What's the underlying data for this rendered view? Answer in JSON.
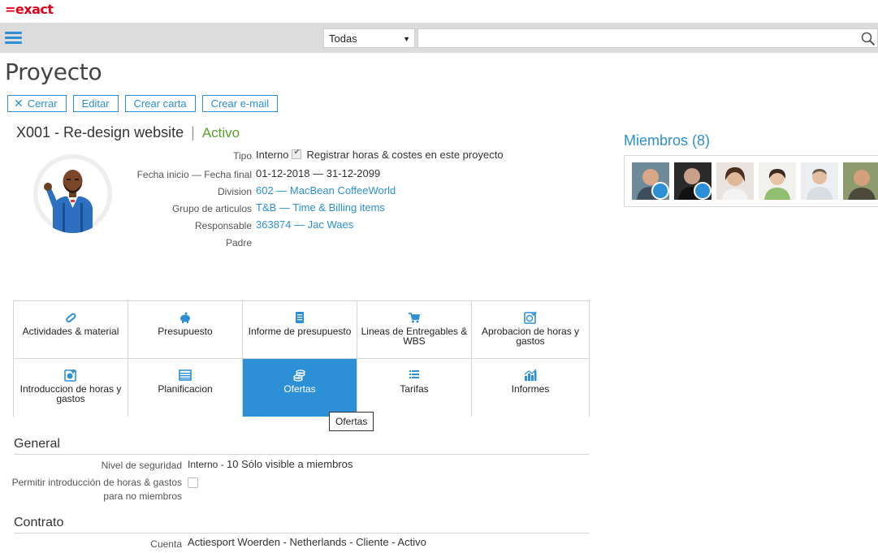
{
  "brand": {
    "logo": "=exact"
  },
  "topbar": {
    "scope_selected": "Todas",
    "search_placeholder": ""
  },
  "page": {
    "title": "Proyecto"
  },
  "actions": {
    "close": "Cerrar",
    "edit": "Editar",
    "create_letter": "Crear carta",
    "create_email": "Crear e-mail"
  },
  "project": {
    "code_name": "X001 - Re-design website",
    "separator": "|",
    "status": "Activo",
    "props": [
      {
        "label": "Tipo",
        "value": "Interno",
        "checkbox_text": "Registrar horas & costes en este proyecto"
      },
      {
        "label": "Fecha inicio — Fecha final",
        "value": "01-12-2018 — 31-12-2099"
      },
      {
        "label": "Division",
        "value": "602 — MacBean CoffeeWorld"
      },
      {
        "label": "Grupo de articulos",
        "value": "T&B — Time & Billing items"
      },
      {
        "label": "Responsable",
        "value": "363874 — Jac Waes"
      },
      {
        "label": "Padre",
        "value": ""
      }
    ]
  },
  "members": {
    "title": "Miembros (8)",
    "count_shown": 6
  },
  "tiles": [
    {
      "label": "Actividades & material",
      "icon": "pill-icon"
    },
    {
      "label": "Presupuesto",
      "icon": "piggy-bank-icon"
    },
    {
      "label": "Informe de presupuesto",
      "icon": "report-book-icon"
    },
    {
      "label": "Lineas de Entregables & WBS",
      "icon": "cart-icon"
    },
    {
      "label": "Aprobacion de horas y gastos",
      "icon": "approve-clock-icon"
    },
    {
      "label": "Introduccion de horas y gastos",
      "icon": "clock-entry-icon"
    },
    {
      "label": "Planificacion",
      "icon": "planning-icon"
    },
    {
      "label": "Ofertas",
      "icon": "coins-icon"
    },
    {
      "label": "Tarifas",
      "icon": "list-icon"
    },
    {
      "label": "Informes",
      "icon": "bar-chart-icon"
    }
  ],
  "tooltip": "Ofertas",
  "general": {
    "title": "General",
    "security_label": "Nivel de seguridad",
    "security_value_a": "Interno - ",
    "security_value_b": "10",
    "security_value_c": " Sólo visible a miembros",
    "allow_label": "Permitir introducción de horas & gastos para no miembros"
  },
  "contract": {
    "title": "Contrato",
    "account_label": "Cuenta",
    "account_value": "Actiesport Woerden - Netherlands - Cliente - Activo"
  },
  "colors": {
    "accent": "#2d8fd5",
    "brand": "#e1001a",
    "status_active": "#5aa02c"
  }
}
